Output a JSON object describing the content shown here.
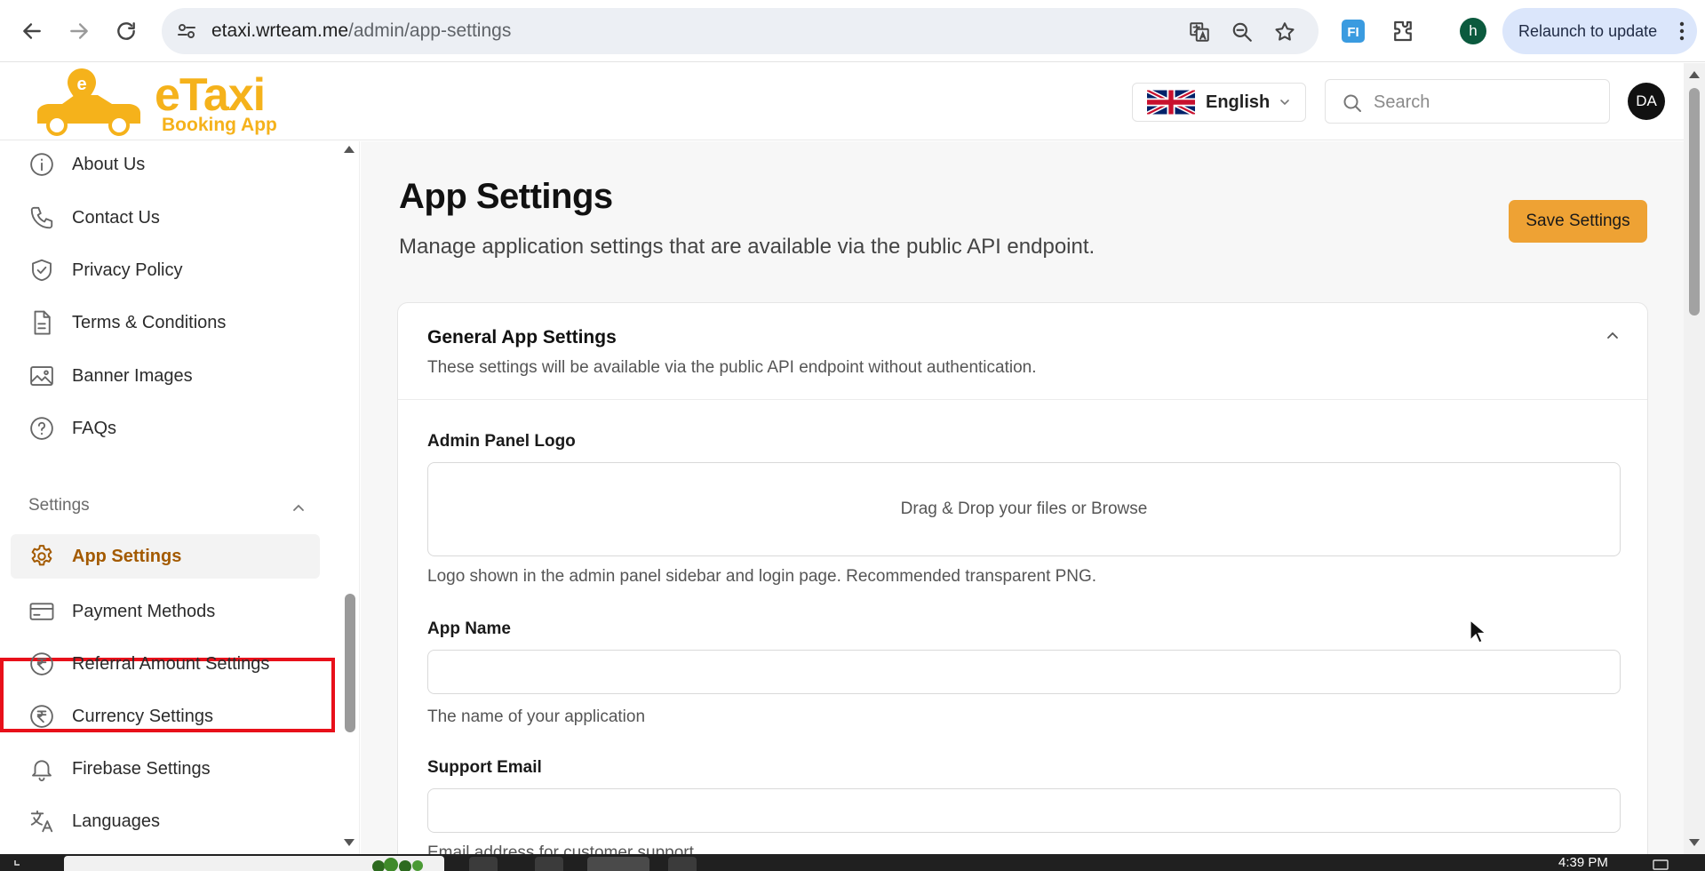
{
  "browser": {
    "url_host": "etaxi.wrteam.me",
    "url_path": "/admin/app-settings",
    "profile_initial": "h",
    "relaunch_label": "Relaunch to update"
  },
  "header": {
    "logo_main": "eTaxi",
    "logo_sub": "Booking App",
    "language": "English",
    "search_placeholder": "Search",
    "avatar_initials": "DA"
  },
  "sidebar": {
    "items": [
      {
        "label": "About Us",
        "icon": "info-icon"
      },
      {
        "label": "Contact Us",
        "icon": "phone-icon"
      },
      {
        "label": "Privacy Policy",
        "icon": "shield-check-icon"
      },
      {
        "label": "Terms & Conditions",
        "icon": "document-icon"
      },
      {
        "label": "Banner Images",
        "icon": "image-icon"
      },
      {
        "label": "FAQs",
        "icon": "help-circle-icon"
      }
    ],
    "section_title": "Settings",
    "settings_items": [
      {
        "label": "App Settings",
        "icon": "gear-icon",
        "active": true
      },
      {
        "label": "Payment Methods",
        "icon": "credit-card-icon"
      },
      {
        "label": "Referral Amount Settings",
        "icon": "rupee-icon"
      },
      {
        "label": "Currency Settings",
        "icon": "rupee-icon"
      },
      {
        "label": "Firebase Settings",
        "icon": "bell-icon"
      },
      {
        "label": "Languages",
        "icon": "translate-icon"
      }
    ]
  },
  "main": {
    "title": "App Settings",
    "subtitle": "Manage application settings that are available via the public API endpoint.",
    "save_label": "Save Settings",
    "card": {
      "title": "General App Settings",
      "description": "These settings will be available via the public API endpoint without authentication.",
      "fields": {
        "logo_label": "Admin Panel Logo",
        "dropzone_text": "Drag & Drop your files or Browse",
        "logo_help": "Logo shown in the admin panel sidebar and login page. Recommended transparent PNG.",
        "app_name_label": "App Name",
        "app_name_value": "",
        "app_name_help": "The name of your application",
        "support_email_label": "Support Email",
        "support_email_value": "",
        "support_email_help": "Email address for customer support"
      }
    }
  },
  "taskbar": {
    "time": "4:39 PM"
  },
  "colors": {
    "brand": "#f5b21b",
    "save_button": "#eea234",
    "active_text": "#a35a00",
    "highlight": "#e8101a"
  }
}
